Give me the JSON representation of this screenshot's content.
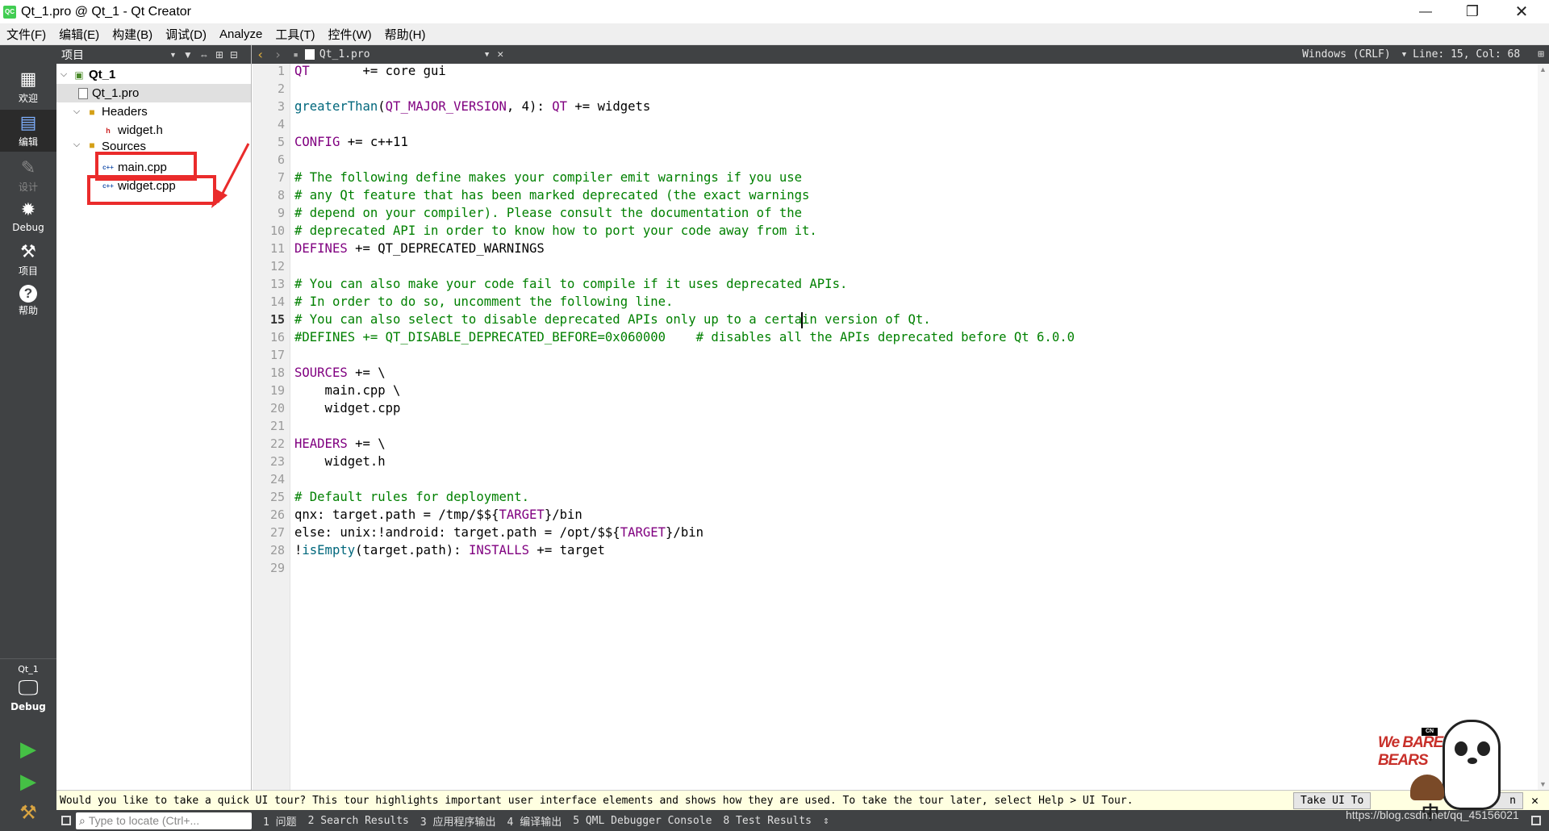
{
  "window": {
    "title": "Qt_1.pro @ Qt_1 - Qt Creator",
    "app_icon": "QC",
    "minimize": "—",
    "restore": "❐",
    "close": "✕"
  },
  "menu": [
    "文件(F)",
    "编辑(E)",
    "构建(B)",
    "调试(D)",
    "Analyze",
    "工具(T)",
    "控件(W)",
    "帮助(H)"
  ],
  "modes": [
    {
      "label": "欢迎",
      "icon": "grid-icon",
      "glyph": "▦"
    },
    {
      "label": "编辑",
      "icon": "edit-icon",
      "glyph": "▤"
    },
    {
      "label": "设计",
      "icon": "pen-icon",
      "glyph": "✎"
    },
    {
      "label": "Debug",
      "icon": "bug-icon",
      "glyph": "✹"
    },
    {
      "label": "项目",
      "icon": "wrench-icon",
      "glyph": "⚒"
    },
    {
      "label": "帮助",
      "icon": "help-icon",
      "glyph": "?"
    }
  ],
  "kit": {
    "project": "Qt_1",
    "build": "Debug"
  },
  "run": {
    "run_glyph": "▶",
    "debug_glyph": "▶",
    "build_glyph": "⚒"
  },
  "project_pane": {
    "title": "项目",
    "filter": "▼",
    "link": "⇔",
    "split": "⊞",
    "close": "⊟"
  },
  "tree": [
    {
      "label": "Qt_1",
      "depth": 0,
      "expanded": true,
      "bold": true
    },
    {
      "label": "Qt_1.pro",
      "depth": 1,
      "selected": true
    },
    {
      "label": "Headers",
      "depth": 1,
      "expanded": true
    },
    {
      "label": "widget.h",
      "depth": 2
    },
    {
      "label": "Sources",
      "depth": 1,
      "expanded": true
    },
    {
      "label": "main.cpp",
      "depth": 2
    },
    {
      "label": "widget.cpp",
      "depth": 2
    }
  ],
  "editor_toolbar": {
    "file": "Qt_1.pro",
    "encoding": "Windows (CRLF)",
    "position": "Line: 15, Col: 68"
  },
  "code": [
    "QT       += core gui",
    "",
    "greaterThan(QT_MAJOR_VERSION, 4): QT += widgets",
    "",
    "CONFIG += c++11",
    "",
    "# The following define makes your compiler emit warnings if you use",
    "# any Qt feature that has been marked deprecated (the exact warnings",
    "# depend on your compiler). Please consult the documentation of the",
    "# deprecated API in order to know how to port your code away from it.",
    "DEFINES += QT_DEPRECATED_WARNINGS",
    "",
    "# You can also make your code fail to compile if it uses deprecated APIs.",
    "# In order to do so, uncomment the following line.",
    "# You can also select to disable deprecated APIs only up to a certain version of Qt.",
    "#DEFINES += QT_DISABLE_DEPRECATED_BEFORE=0x060000    # disables all the APIs deprecated before Qt 6.0.0",
    "",
    "SOURCES += \\",
    "    main.cpp \\",
    "    widget.cpp",
    "",
    "HEADERS += \\",
    "    widget.h",
    "",
    "# Default rules for deployment.",
    "qnx: target.path = /tmp/$${TARGET}/bin",
    "else: unix:!android: target.path = /opt/$${TARGET}/bin",
    "!isEmpty(target.path): INSTALLS += target",
    ""
  ],
  "current_line": 15,
  "infobar": {
    "message": "Would you like to take a quick UI tour? This tour highlights important user interface elements and shows how they are used. To take the tour later, select Help > UI Tour.",
    "take_tour": "Take UI To",
    "no_thanks": "n",
    "close": "✕"
  },
  "statusbar": {
    "locator_placeholder": "Type to locate (Ctrl+...",
    "tabs": [
      "1 问题",
      "2 Search Results",
      "3 应用程序输出",
      "4 编译输出",
      "5 QML Debugger Console",
      "8 Test Results"
    ],
    "more": "⇕"
  },
  "sticker": {
    "brand": "We BARE BEARS",
    "badge": "CN",
    "char": "中"
  },
  "watermark": "https://blog.csdn.net/qq_45156021",
  "colors": {
    "sidebar": "#404244",
    "highlight": "#ea2b2b",
    "keyword": "#800080",
    "function": "#00677c",
    "comment": "#008000"
  }
}
